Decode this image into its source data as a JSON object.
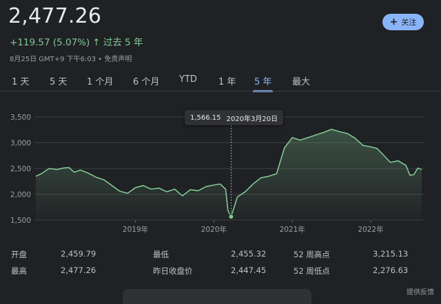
{
  "quote": {
    "price": "2,477.26",
    "change": "+119.57 (5.07%)",
    "change_arrow": "↑",
    "period": "过去 5 年",
    "meta": "8月25日 GMT+9 下午6:03 • 免责声明"
  },
  "follow_button": {
    "label": "关注",
    "icon": "plus-icon"
  },
  "tabs": [
    "1 天",
    "5 天",
    "1 个月",
    "6 个月",
    "YTD",
    "1 年",
    "5 年",
    "最大"
  ],
  "active_tab": "5 年",
  "tooltip": {
    "value": "1,566.15",
    "date": "2020年3月20日"
  },
  "colors": {
    "line": "#81c995",
    "accent": "#8ab4f8",
    "background": "#202124"
  },
  "chart_data": {
    "type": "area",
    "yticks": [
      "3,500",
      "3,000",
      "2,500",
      "2,000",
      "1,500"
    ],
    "ylim": [
      1500,
      3500
    ],
    "xticks": [
      "2019年",
      "2020年",
      "2021年",
      "2022年"
    ],
    "xlim": [
      2017.73,
      2022.65
    ],
    "grid": true,
    "x": [
      2017.73,
      2017.8,
      2017.9,
      2018.0,
      2018.08,
      2018.15,
      2018.22,
      2018.3,
      2018.4,
      2018.5,
      2018.6,
      2018.7,
      2018.8,
      2018.9,
      2019.0,
      2019.1,
      2019.2,
      2019.3,
      2019.4,
      2019.5,
      2019.6,
      2019.7,
      2019.8,
      2019.9,
      2020.0,
      2020.08,
      2020.15,
      2020.18,
      2020.22,
      2020.3,
      2020.4,
      2020.5,
      2020.6,
      2020.7,
      2020.8,
      2020.9,
      2021.0,
      2021.1,
      2021.2,
      2021.3,
      2021.4,
      2021.5,
      2021.6,
      2021.7,
      2021.8,
      2021.9,
      2022.0,
      2022.08,
      2022.15,
      2022.25,
      2022.35,
      2022.45,
      2022.5,
      2022.55,
      2022.6,
      2022.65
    ],
    "y": [
      2350,
      2400,
      2500,
      2480,
      2510,
      2520,
      2430,
      2470,
      2410,
      2330,
      2280,
      2170,
      2060,
      2020,
      2130,
      2170,
      2100,
      2120,
      2050,
      2100,
      1970,
      2090,
      2070,
      2150,
      2180,
      2200,
      2100,
      1680,
      1566,
      1950,
      2050,
      2200,
      2320,
      2350,
      2400,
      2900,
      3100,
      3050,
      3100,
      3150,
      3200,
      3260,
      3215,
      3180,
      3090,
      2950,
      2920,
      2890,
      2780,
      2620,
      2650,
      2560,
      2370,
      2380,
      2510,
      2477
    ]
  },
  "stats": [
    {
      "label": "开盘",
      "value": "2,459.79"
    },
    {
      "label": "最高",
      "value": "2,477.26"
    },
    {
      "label": "最低",
      "value": "2,455.32"
    },
    {
      "label": "昨日收盘价",
      "value": "2,447.45"
    },
    {
      "label": "52 周高点",
      "value": "3,215.13"
    },
    {
      "label": "52 周低点",
      "value": "2,276.63"
    }
  ],
  "feedback": "提供反馈"
}
